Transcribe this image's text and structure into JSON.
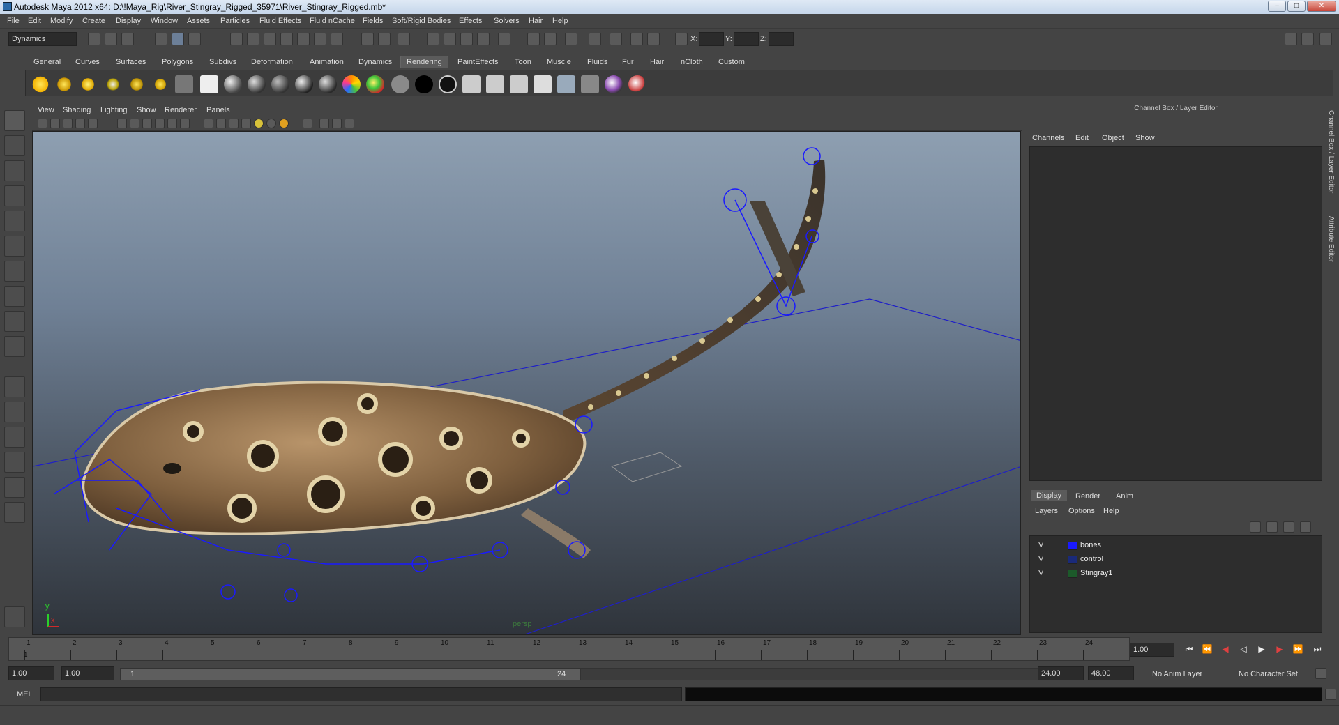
{
  "window": {
    "title": "Autodesk Maya 2012 x64: D:\\!Maya_Rig\\River_Stingray_Rigged_35971\\River_Stingray_Rigged.mb*",
    "buttons": [
      "–",
      "□",
      "✕"
    ]
  },
  "menubar": [
    "File",
    "Edit",
    "Modify",
    "Create",
    "Display",
    "Window",
    "Assets",
    "Particles",
    "Fluid Effects",
    "Fluid nCache",
    "Fields",
    "Soft/Rigid Bodies",
    "Effects",
    "Solvers",
    "Hair",
    "Help"
  ],
  "statusline": {
    "menuset": "Dynamics",
    "x_label": "X:",
    "y_label": "Y:",
    "z_label": "Z:"
  },
  "shelf": {
    "tabs": [
      "General",
      "Curves",
      "Surfaces",
      "Polygons",
      "Subdivs",
      "Deformation",
      "Animation",
      "Dynamics",
      "Rendering",
      "PaintEffects",
      "Toon",
      "Muscle",
      "Fluids",
      "Fur",
      "Hair",
      "nCloth",
      "Custom"
    ],
    "active_tab": "Rendering"
  },
  "viewport": {
    "menu": [
      "View",
      "Shading",
      "Lighting",
      "Show",
      "Renderer",
      "Panels"
    ],
    "camera_label": "persp",
    "axis_y": "y",
    "axis_x": "x"
  },
  "channelbox": {
    "title": "Channel Box / Layer Editor",
    "menu": [
      "Channels",
      "Edit",
      "Object",
      "Show"
    ],
    "side_tabs": [
      "Channel Box / Layer Editor",
      "Attribute Editor"
    ]
  },
  "layers": {
    "tabs": [
      "Display",
      "Render",
      "Anim"
    ],
    "active_tab": "Display",
    "menu": [
      "Layers",
      "Options",
      "Help"
    ],
    "rows": [
      {
        "v": "V",
        "name": "bones",
        "color": "#1a1aff"
      },
      {
        "v": "V",
        "name": "control",
        "color": "#1a2a7a"
      },
      {
        "v": "V",
        "name": "Stingray1",
        "color": "#1c5a2a"
      }
    ]
  },
  "timeslider": {
    "ticks": [
      "1",
      "2",
      "3",
      "4",
      "5",
      "6",
      "7",
      "8",
      "9",
      "10",
      "11",
      "12",
      "13",
      "14",
      "15",
      "16",
      "17",
      "18",
      "19",
      "20",
      "21",
      "22",
      "23",
      "24"
    ],
    "current_frame_label": "1",
    "current_time": "1.00"
  },
  "rangeslider": {
    "start_time": "1.00",
    "playback_start": "1.00",
    "range_start_label": "1",
    "range_end_label": "24",
    "playback_end": "24.00",
    "end_time": "48.00",
    "anim_layer": "No Anim Layer",
    "character_set": "No Character Set"
  },
  "cmdline": {
    "label": "MEL"
  }
}
